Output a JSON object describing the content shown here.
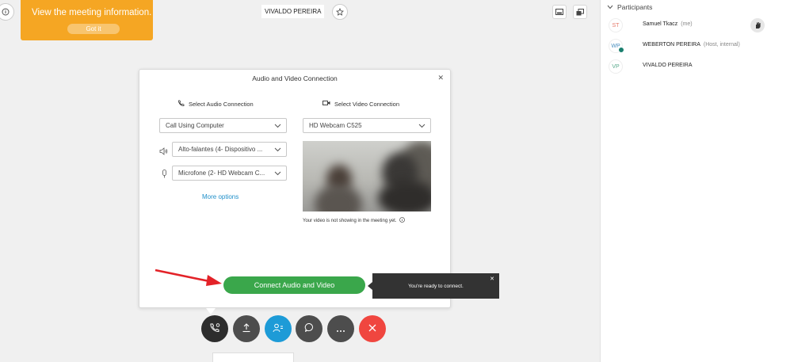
{
  "tooltip": {
    "text": "View the meeting information.",
    "button": "Got it"
  },
  "header": {
    "host_name": "VIVALDO PEREIRA"
  },
  "dialog": {
    "title": "Audio and Video Connection",
    "audio_heading": "Select Audio Connection",
    "video_heading": "Select Video Connection",
    "audio_mode": "Call Using Computer",
    "speaker": "Alto-falantes (4- Dispositivo ...",
    "microphone": "Microfone (2- HD Webcam C...",
    "more_options": "More options",
    "camera": "HD Webcam C525",
    "video_note": "Your video is not showing in the meeting yet.",
    "connect_button": "Connect Audio and Video"
  },
  "ready_tooltip": {
    "text": "You're ready to connect."
  },
  "participants": {
    "heading": "Participants",
    "items": [
      {
        "initials": "ST",
        "name": "Samuel Tkacz",
        "role": "(me)",
        "color": "#e57a6b"
      },
      {
        "initials": "WP",
        "name": "WEBERTON PEREIRA",
        "role": "(Host, internal)",
        "color": "#4a8fbf"
      },
      {
        "initials": "VP",
        "name": "VIVALDO PEREIRA",
        "role": "",
        "color": "#5aaa8c"
      }
    ]
  },
  "colors": {
    "accent_orange": "#f5a623",
    "connect_green": "#3aa74b",
    "end_red": "#f0463f",
    "share_blue": "#1d9bd7",
    "link_blue": "#1f8fc9"
  }
}
